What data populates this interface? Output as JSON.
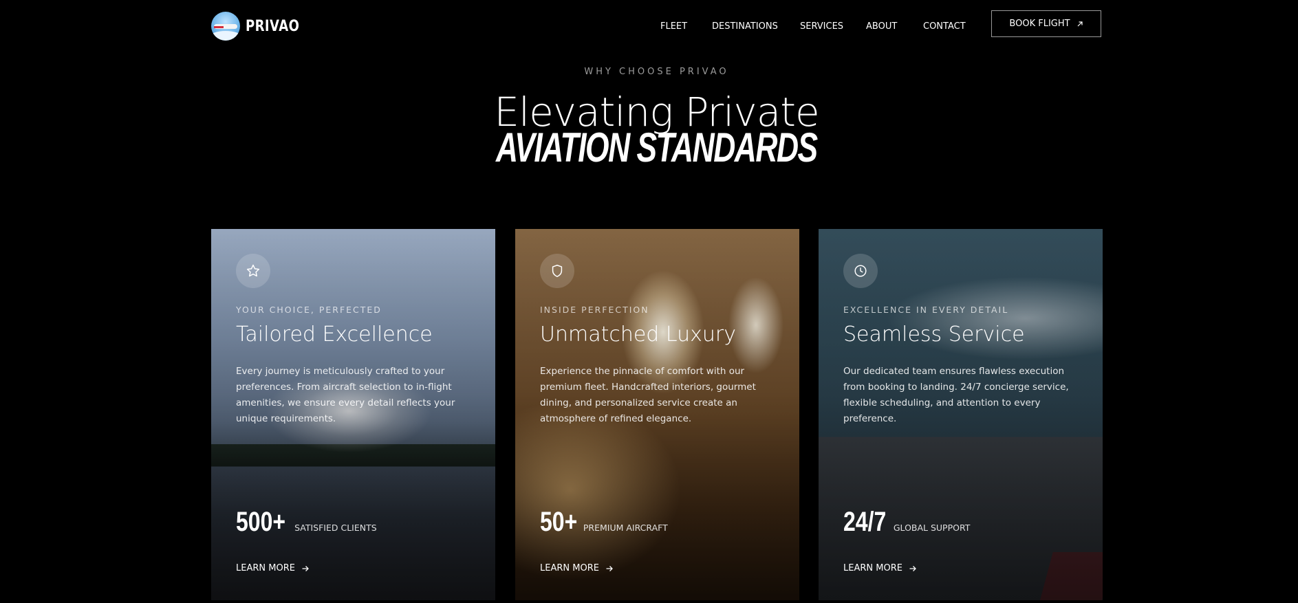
{
  "brand": {
    "name": "PRIVAO"
  },
  "nav": {
    "items": [
      "FLEET",
      "DESTINATIONS",
      "SERVICES",
      "ABOUT",
      "CONTACT"
    ],
    "cta": "BOOK FLIGHT"
  },
  "hero": {
    "eyebrow": "WHY CHOOSE PRIVAO",
    "title_line1": "Elevating Private",
    "title_line2": "AVIATION STANDARDS"
  },
  "cards": [
    {
      "icon": "star-icon",
      "kicker": "YOUR CHOICE, PERFECTED",
      "title": "Tailored Excellence",
      "description": "Every journey is meticulously crafted to your preferences. From aircraft selection to in-flight amenities, we ensure every detail reflects your unique requirements.",
      "stat_value": "500+",
      "stat_label": "SATISFIED CLIENTS",
      "link": "LEARN MORE"
    },
    {
      "icon": "shield-icon",
      "kicker": "INSIDE PERFECTION",
      "title": "Unmatched Luxury",
      "description": "Experience the pinnacle of comfort with our premium fleet. Handcrafted interiors, gourmet dining, and personalized service create an atmosphere of refined elegance.",
      "stat_value": "50+",
      "stat_label": "PREMIUM AIRCRAFT",
      "link": "LEARN MORE"
    },
    {
      "icon": "clock-icon",
      "kicker": "EXCELLENCE IN EVERY DETAIL",
      "title": "Seamless Service",
      "description": "Our dedicated team ensures flawless execution from booking to landing. 24/7 concierge service, flexible scheduling, and attention to every preference.",
      "stat_value": "24/7",
      "stat_label": "GLOBAL SUPPORT",
      "link": "LEARN MORE"
    }
  ]
}
